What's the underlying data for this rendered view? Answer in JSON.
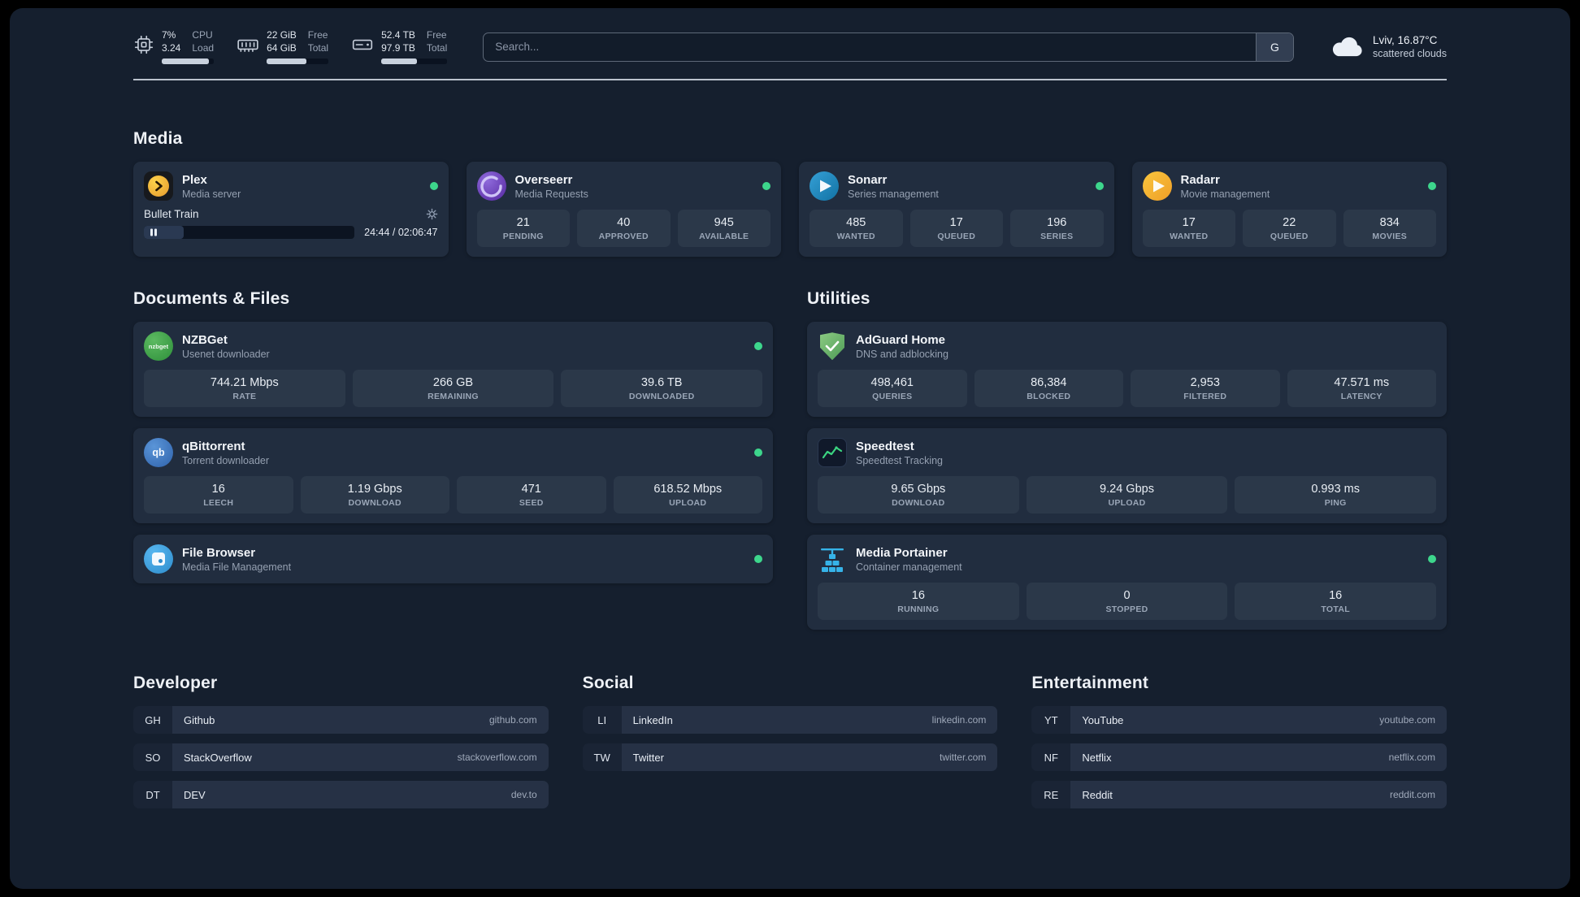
{
  "colors": {
    "status_green": "#3dd68c"
  },
  "topbar": {
    "cpu": {
      "value_top": "7%",
      "value_bottom": "3.24",
      "label_top": "CPU",
      "label_bottom": "Load",
      "progress": 90
    },
    "memory": {
      "value_top": "22 GiB",
      "value_bottom": "64 GiB",
      "label_top": "Free",
      "label_bottom": "Total",
      "progress": 65
    },
    "disk": {
      "value_top": "52.4 TB",
      "value_bottom": "97.9 TB",
      "label_top": "Free",
      "label_bottom": "Total",
      "progress": 54
    },
    "search": {
      "placeholder": "Search...",
      "provider_label": "G"
    },
    "weather": {
      "location": "Lviv, 16.87°C",
      "condition": "scattered clouds"
    }
  },
  "media": {
    "title": "Media",
    "items": [
      {
        "name": "Plex",
        "subtitle": "Media server",
        "online": true,
        "player": {
          "now_playing": "Bullet Train",
          "time": "24:44 / 02:06:47",
          "progress": 19
        }
      },
      {
        "name": "Overseerr",
        "subtitle": "Media Requests",
        "online": true,
        "stats": [
          {
            "value": "21",
            "label": "PENDING"
          },
          {
            "value": "40",
            "label": "APPROVED"
          },
          {
            "value": "945",
            "label": "AVAILABLE"
          }
        ]
      },
      {
        "name": "Sonarr",
        "subtitle": "Series management",
        "online": true,
        "stats": [
          {
            "value": "485",
            "label": "WANTED"
          },
          {
            "value": "17",
            "label": "QUEUED"
          },
          {
            "value": "196",
            "label": "SERIES"
          }
        ]
      },
      {
        "name": "Radarr",
        "subtitle": "Movie management",
        "online": true,
        "stats": [
          {
            "value": "17",
            "label": "WANTED"
          },
          {
            "value": "22",
            "label": "QUEUED"
          },
          {
            "value": "834",
            "label": "MOVIES"
          }
        ]
      }
    ]
  },
  "documents": {
    "title": "Documents & Files",
    "items": [
      {
        "name": "NZBGet",
        "subtitle": "Usenet downloader",
        "online": true,
        "icon_text": "nzbget",
        "stats": [
          {
            "value": "744.21 Mbps",
            "label": "RATE"
          },
          {
            "value": "266 GB",
            "label": "REMAINING"
          },
          {
            "value": "39.6 TB",
            "label": "DOWNLOADED"
          }
        ]
      },
      {
        "name": "qBittorrent",
        "subtitle": "Torrent downloader",
        "online": true,
        "icon_text": "qb",
        "stats": [
          {
            "value": "16",
            "label": "LEECH"
          },
          {
            "value": "1.19 Gbps",
            "label": "DOWNLOAD"
          },
          {
            "value": "471",
            "label": "SEED"
          },
          {
            "value": "618.52 Mbps",
            "label": "UPLOAD"
          }
        ]
      },
      {
        "name": "File Browser",
        "subtitle": "Media File Management",
        "online": true,
        "stats": []
      }
    ]
  },
  "utilities": {
    "title": "Utilities",
    "items": [
      {
        "name": "AdGuard Home",
        "subtitle": "DNS and adblocking",
        "online": false,
        "stats": [
          {
            "value": "498,461",
            "label": "QUERIES"
          },
          {
            "value": "86,384",
            "label": "BLOCKED"
          },
          {
            "value": "2,953",
            "label": "FILTERED"
          },
          {
            "value": "47.571 ms",
            "label": "LATENCY"
          }
        ]
      },
      {
        "name": "Speedtest",
        "subtitle": "Speedtest Tracking",
        "online": false,
        "stats": [
          {
            "value": "9.65 Gbps",
            "label": "DOWNLOAD"
          },
          {
            "value": "9.24 Gbps",
            "label": "UPLOAD"
          },
          {
            "value": "0.993 ms",
            "label": "PING"
          }
        ]
      },
      {
        "name": "Media Portainer",
        "subtitle": "Container management",
        "online": true,
        "stats": [
          {
            "value": "16",
            "label": "RUNNING"
          },
          {
            "value": "0",
            "label": "STOPPED"
          },
          {
            "value": "16",
            "label": "TOTAL"
          }
        ]
      }
    ]
  },
  "bookmark_groups": [
    {
      "title": "Developer",
      "links": [
        {
          "abbr": "GH",
          "name": "Github",
          "domain": "github.com"
        },
        {
          "abbr": "SO",
          "name": "StackOverflow",
          "domain": "stackoverflow.com"
        },
        {
          "abbr": "DT",
          "name": "DEV",
          "domain": "dev.to"
        }
      ]
    },
    {
      "title": "Social",
      "links": [
        {
          "abbr": "LI",
          "name": "LinkedIn",
          "domain": "linkedin.com"
        },
        {
          "abbr": "TW",
          "name": "Twitter",
          "domain": "twitter.com"
        }
      ]
    },
    {
      "title": "Entertainment",
      "links": [
        {
          "abbr": "YT",
          "name": "YouTube",
          "domain": "youtube.com"
        },
        {
          "abbr": "NF",
          "name": "Netflix",
          "domain": "netflix.com"
        },
        {
          "abbr": "RE",
          "name": "Reddit",
          "domain": "reddit.com"
        }
      ]
    }
  ]
}
